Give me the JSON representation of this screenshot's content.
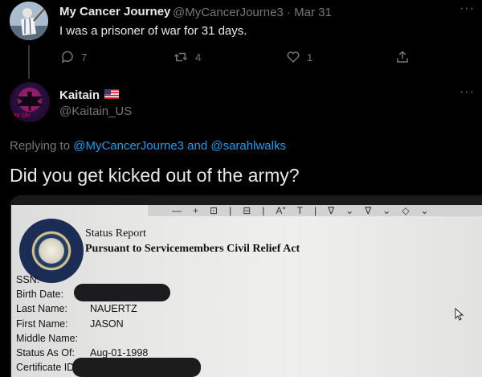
{
  "tweet1": {
    "display_name": "My Cancer Journey",
    "handle": "@MyCancerJourne3",
    "separator": "·",
    "date": "Mar 31",
    "text": "I was a prisoner of war for 31 days.",
    "more": "···",
    "replies": "7",
    "retweets": "4",
    "likes": "1"
  },
  "tweet2": {
    "display_name": "Kaitain",
    "flag": "🇺🇸",
    "handle": "@Kaitain_US",
    "avatar_text": "rity Un",
    "more": "···",
    "replying_prefix": "Replying to",
    "replying_users": "@MyCancerJourne3 and @sarahlwalks",
    "text": "Did you get kicked out of the army?"
  },
  "document": {
    "toolbar_glyphs": [
      "—",
      "+",
      "⊡",
      "|",
      "⊟",
      "|",
      "A\"",
      "T",
      "|",
      "∇",
      "⌄",
      "∇",
      "⌄",
      "◇",
      "⌄"
    ],
    "title_line1": "Status Report",
    "title_line2": "Pursuant to Servicemembers Civil Relief Act",
    "fields": {
      "ssn_label": "SSN:",
      "birth_label": "Birth Date:",
      "last_label": "Last Name:",
      "last_value": "NAUERTZ",
      "first_label": "First Name:",
      "first_value": "JASON",
      "middle_label": "Middle Name:",
      "status_label": "Status As Of:",
      "status_value": "Aug-01-1998",
      "cert_label": "Certificate ID"
    }
  },
  "colors": {
    "background": "#000000",
    "text": "#e7e9ea",
    "muted": "#71767b",
    "link": "#1d9bf0"
  }
}
